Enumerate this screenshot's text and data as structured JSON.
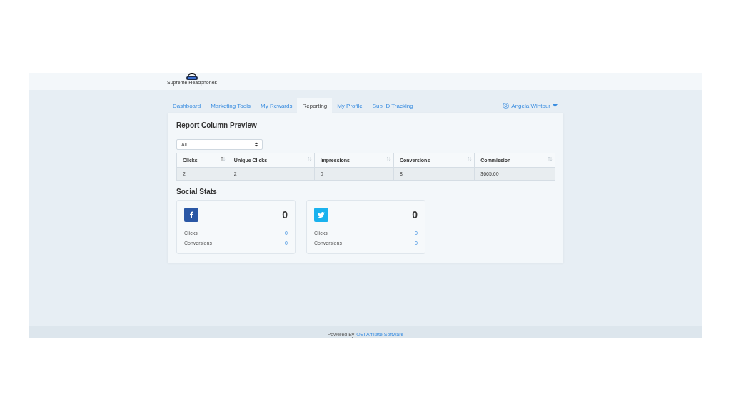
{
  "logo": {
    "text": "Supreme Headphones"
  },
  "tabs": [
    {
      "label": "Dashboard",
      "selected": false
    },
    {
      "label": "Marketing Tools",
      "selected": false
    },
    {
      "label": "My Rewards",
      "selected": false
    },
    {
      "label": "Reporting",
      "selected": true
    },
    {
      "label": "My Profile",
      "selected": false
    },
    {
      "label": "Sub ID Tracking",
      "selected": false
    }
  ],
  "user_menu": {
    "label": "Angela Wintour"
  },
  "report": {
    "title": "Report Column Preview",
    "filter": {
      "value": "All"
    },
    "columns": [
      {
        "label": "Clicks",
        "sorted": true
      },
      {
        "label": "Unique Clicks",
        "sorted": false
      },
      {
        "label": "Impressions",
        "sorted": false
      },
      {
        "label": "Conversions",
        "sorted": false
      },
      {
        "label": "Commission",
        "sorted": false
      }
    ],
    "rows": [
      [
        "2",
        "2",
        "0",
        "8",
        "$665.60"
      ]
    ]
  },
  "social": {
    "title": "Social Stats",
    "cards": [
      {
        "kind": "facebook",
        "total": "0",
        "stats": [
          {
            "label": "Clicks",
            "value": "0"
          },
          {
            "label": "Conversions",
            "value": "0"
          }
        ]
      },
      {
        "kind": "twitter",
        "total": "0",
        "stats": [
          {
            "label": "Clicks",
            "value": "0"
          },
          {
            "label": "Conversions",
            "value": "0"
          }
        ]
      }
    ]
  },
  "footer": {
    "text": "Powered By",
    "link": "OSI Affiliate Software"
  }
}
